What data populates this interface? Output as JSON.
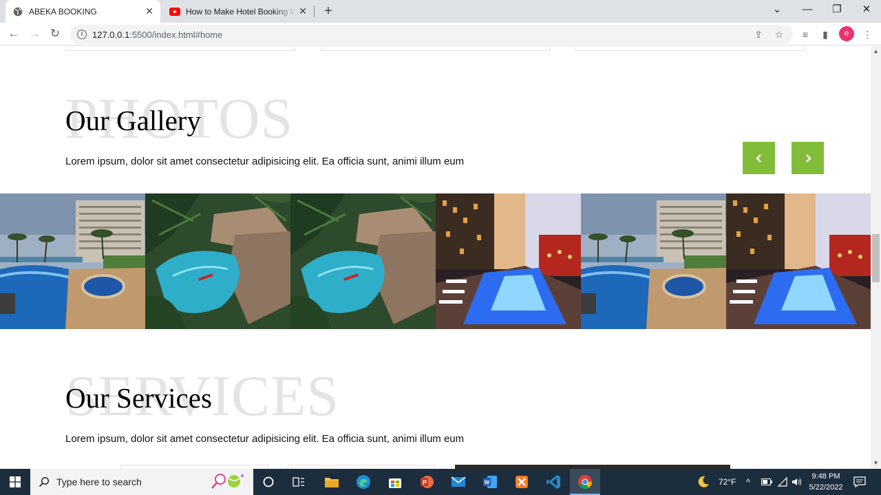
{
  "browser": {
    "tabs": [
      {
        "title": "ABEKA BOOKING",
        "active": true
      },
      {
        "title": "How to Make Hotel Booking Web",
        "active": false
      }
    ],
    "url_host": "127.0.0.1",
    "url_rest": ":5500/index.html#home",
    "profile_initial": "e",
    "colors": {
      "profile": "#e8336e",
      "tabstrip": "#dee1e6"
    }
  },
  "gallery": {
    "bg_word": "PHOTOS",
    "title": "Our Gallery",
    "text": "Lorem ipsum, dolor sit amet consectetur adipisicing elit. Ea officia sunt, animi illum eum",
    "prev_icon": "chevron-left-icon",
    "next_icon": "chevron-right-icon",
    "accent": "#82bd3a",
    "photos": [
      "resort-pool",
      "jungle-pool",
      "jungle-pool",
      "city-rooftop-pool",
      "resort-pool",
      "city-rooftop-pool"
    ]
  },
  "services": {
    "bg_word": "SERVICES",
    "title": "Our Services",
    "text": "Lorem ipsum, dolor sit amet consectetur adipisicing elit. Ea officia sunt, animi illum eum"
  },
  "taskbar": {
    "search_placeholder": "Type here to search",
    "weather": "72°F",
    "time": "9:48 PM",
    "date": "5/22/2022"
  }
}
